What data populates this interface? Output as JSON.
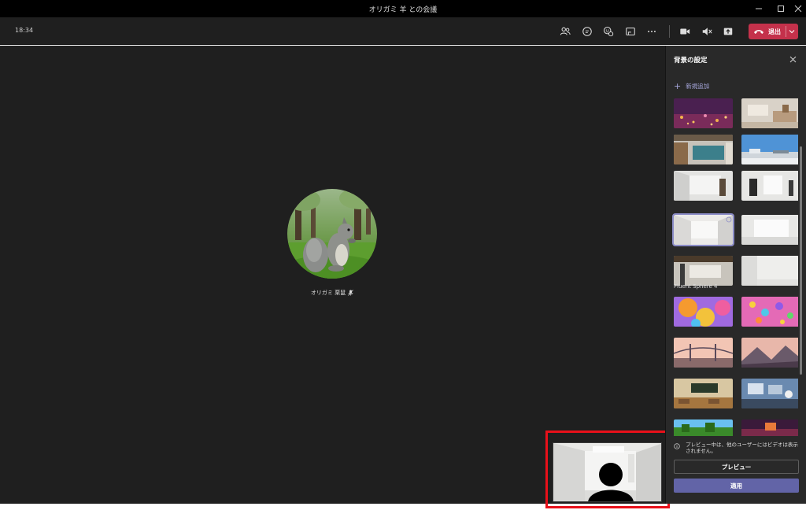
{
  "window": {
    "title": "オリガミ 羊 との会議"
  },
  "toolbar": {
    "time": "18:34",
    "leave_label": "退出",
    "icons": [
      "participants-icon",
      "chat-icon",
      "reactions-icon",
      "share-tray-icon",
      "more-icon",
      "camera-icon",
      "speaker-muted-icon",
      "share-screen-icon",
      "phone-hangup-icon"
    ],
    "leave_color": "#c4314b"
  },
  "stage": {
    "participant_name": "オリガミ 栗鼠"
  },
  "panel": {
    "title": "背景の設定",
    "add_new": "新規追加",
    "selected_label": "Fluent Sphere 4",
    "info_text": "プレビュー中は、他のユーザーにはビデオは表示されません。",
    "preview_button": "プレビュー",
    "apply_button": "適用",
    "accent": "#6264a7"
  }
}
